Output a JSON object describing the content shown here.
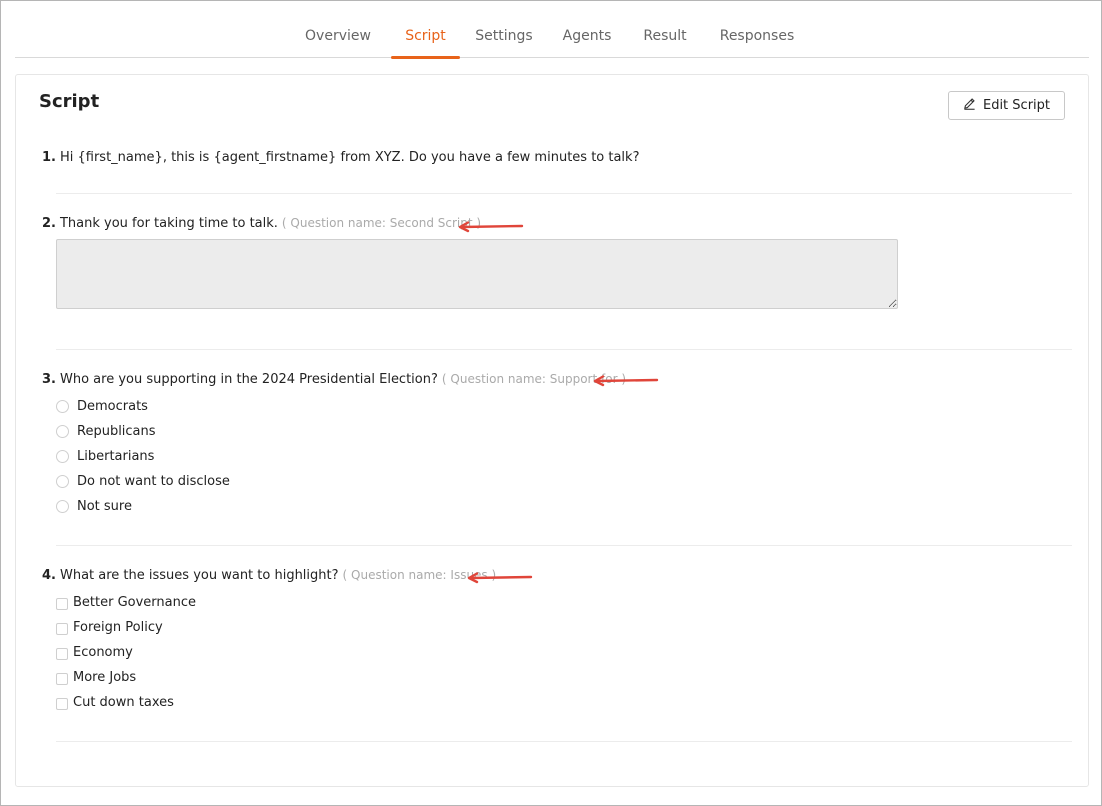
{
  "tabs": [
    {
      "label": "Overview"
    },
    {
      "label": "Script"
    },
    {
      "label": "Settings"
    },
    {
      "label": "Agents"
    },
    {
      "label": "Result"
    },
    {
      "label": "Responses"
    }
  ],
  "active_tab": "Script",
  "card": {
    "title": "Script",
    "edit_button": "Edit Script"
  },
  "questions": [
    {
      "number": "1.",
      "text": "Hi {first_name}, this is {agent_firstname} from XYZ. Do you have a few minutes to talk?"
    },
    {
      "number": "2.",
      "text": "Thank you for taking time to talk.",
      "meta": "( Question name: Second Script )"
    },
    {
      "number": "3.",
      "text": "Who are you supporting in the 2024 Presidential Election?",
      "meta": "( Question name: Support for )",
      "options": [
        "Democrats",
        "Republicans",
        "Libertarians",
        "Do not want to disclose",
        "Not sure"
      ]
    },
    {
      "number": "4.",
      "text": "What are the issues you want to highlight?",
      "meta": "( Question name: Issues )",
      "options": [
        "Better Governance",
        "Foreign Policy",
        "Economy",
        "More Jobs",
        "Cut down taxes"
      ]
    }
  ],
  "colors": {
    "accent": "#e8631a",
    "annotation_arrow": "#e0453a",
    "meta_text": "#aaaaaa"
  },
  "icons": {
    "edit": "pencil-icon",
    "arrow": "left-arrow-annotation"
  }
}
